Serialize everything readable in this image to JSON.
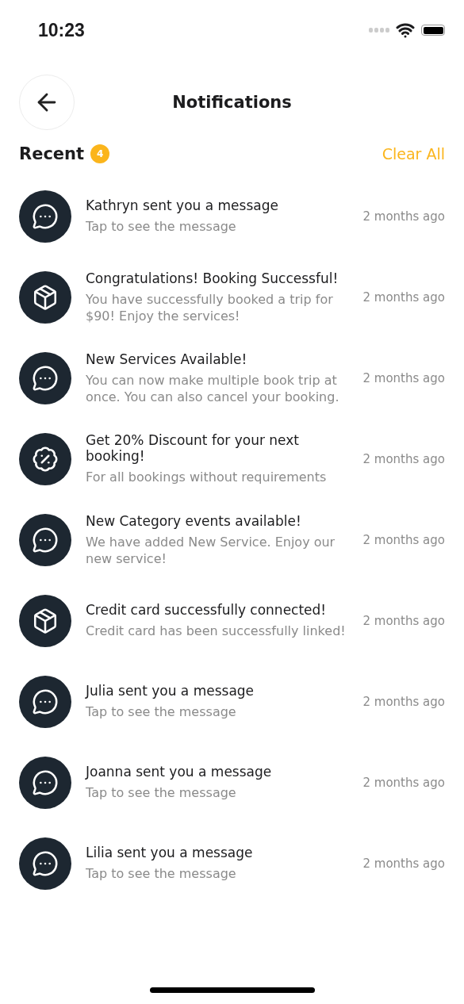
{
  "status_bar": {
    "time": "10:23"
  },
  "header": {
    "title": "Notifications"
  },
  "section": {
    "title": "Recent",
    "count": "4",
    "action": "Clear All"
  },
  "notifications": [
    {
      "kind": "message",
      "title": "Kathryn sent you a message",
      "body": "Tap to see the message",
      "time": "2 months ago"
    },
    {
      "kind": "box",
      "title": "Congratulations! Booking Successful!",
      "body": "You have successfully booked a trip for $90! Enjoy the services!",
      "time": "2 months ago"
    },
    {
      "kind": "message",
      "title": "New Services Available!",
      "body": "You can now make multiple book trip at once. You can also cancel your booking.",
      "time": "2 months ago"
    },
    {
      "kind": "discount",
      "title": "Get 20% Discount for your next booking!",
      "body": "For all bookings without requirements",
      "time": "2 months ago"
    },
    {
      "kind": "message",
      "title": "New Category events available!",
      "body": "We have added New Service. Enjoy our new service!",
      "time": "2 months ago"
    },
    {
      "kind": "box",
      "title": "Credit card successfully connected!",
      "body": "Credit card has been successfully linked!",
      "time": "2 months ago"
    },
    {
      "kind": "message",
      "title": "Julia sent you a message",
      "body": "Tap to see the message",
      "time": "2 months ago"
    },
    {
      "kind": "message",
      "title": "Joanna sent you a message",
      "body": "Tap to see the message",
      "time": "2 months ago"
    },
    {
      "kind": "message",
      "title": "Lilia sent you a message",
      "body": "Tap to see the message",
      "time": "2 months ago"
    }
  ]
}
